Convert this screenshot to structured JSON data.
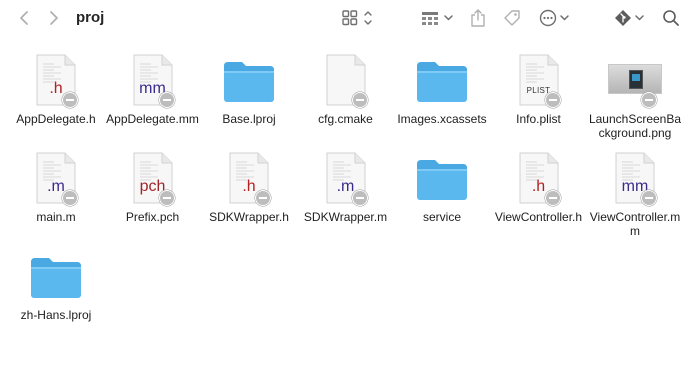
{
  "toolbar": {
    "title": "proj"
  },
  "colors": {
    "folder": "#5ab8ef",
    "ext_h": "#b22222",
    "ext_m": "#3c2a8c",
    "ext_pch": "#a0252a"
  },
  "files": [
    {
      "name": "AppDelegate.h",
      "kind": "doc",
      "ext": ".h",
      "ext_color": "#b22222",
      "icon": "header-file-icon"
    },
    {
      "name": "AppDelegate.mm",
      "kind": "doc",
      "ext": "mm",
      "ext_color": "#3c2a8c",
      "icon": "objcpp-file-icon"
    },
    {
      "name": "Base.lproj",
      "kind": "folder",
      "icon": "folder-icon"
    },
    {
      "name": "cfg.cmake",
      "kind": "blank",
      "icon": "blank-file-icon"
    },
    {
      "name": "Images.xcassets",
      "kind": "folder",
      "icon": "folder-icon"
    },
    {
      "name": "Info.plist",
      "kind": "doc",
      "ext": "PLIST",
      "ext_color": "#333333",
      "small": true,
      "icon": "plist-file-icon"
    },
    {
      "name": "LaunchScreenBackground.png",
      "kind": "png",
      "icon": "image-file-icon"
    },
    {
      "name": "main.m",
      "kind": "doc",
      "ext": ".m",
      "ext_color": "#3c2a8c",
      "icon": "objc-file-icon"
    },
    {
      "name": "Prefix.pch",
      "kind": "doc",
      "ext": "pch",
      "ext_color": "#a0252a",
      "icon": "pch-file-icon"
    },
    {
      "name": "SDKWrapper.h",
      "kind": "doc",
      "ext": ".h",
      "ext_color": "#b22222",
      "icon": "header-file-icon"
    },
    {
      "name": "SDKWrapper.m",
      "kind": "doc",
      "ext": ".m",
      "ext_color": "#3c2a8c",
      "icon": "objc-file-icon"
    },
    {
      "name": "service",
      "kind": "folder",
      "icon": "folder-icon"
    },
    {
      "name": "ViewController.h",
      "kind": "doc",
      "ext": ".h",
      "ext_color": "#b22222",
      "icon": "header-file-icon"
    },
    {
      "name": "ViewController.mm",
      "kind": "doc",
      "ext": "mm",
      "ext_color": "#3c2a8c",
      "icon": "objcpp-file-icon"
    },
    {
      "name": "zh-Hans.lproj",
      "kind": "folder",
      "icon": "folder-icon"
    }
  ]
}
